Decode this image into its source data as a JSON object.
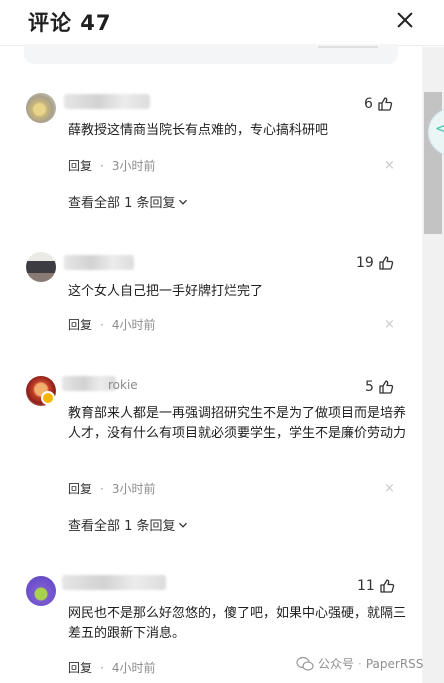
{
  "header": {
    "title": "评论 47"
  },
  "comments": [
    {
      "name": "",
      "likes": "6",
      "text": "薛教授这情商当院长有点难的，专心搞科研吧",
      "reply_label": "回复",
      "time": "3小时前",
      "delete_glyph": "×",
      "view_replies": "查看全部 1 条回复"
    },
    {
      "name": "",
      "likes": "19",
      "text": "这个女人自己把一手好牌打烂完了",
      "reply_label": "回复",
      "time": "4小时前",
      "delete_glyph": "×"
    },
    {
      "name": "rokie",
      "likes": "5",
      "text": "教育部来人都是一再强调招研究生不是为了做项目而是培养人才，没有什么有项目就必须要学生，学生不是廉价劳动力",
      "reply_label": "回复",
      "time": "3小时前",
      "delete_glyph": "×",
      "view_replies": "查看全部 1 条回复"
    },
    {
      "name": "",
      "likes": "11",
      "text": "网民也不是那么好忽悠的，傻了吧，如果中心强硬，就隔三差五的跟新下消息。",
      "reply_label": "回复",
      "time": "4小时前"
    }
  ],
  "separator": "·",
  "watermark": {
    "brand": "公众号",
    "name": "PaperRSS"
  },
  "icons": {
    "close": "close-icon",
    "like": "thumbs-up-icon",
    "expand": "chevron-down-icon",
    "wechat": "wechat-icon"
  }
}
